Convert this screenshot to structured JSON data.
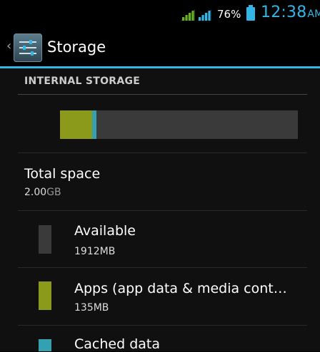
{
  "status_bar": {
    "battery_percent": "76%",
    "time": "12:38",
    "ampm": "AM",
    "colors": {
      "signal1": "#6ab023",
      "signal2": "#33b5e5",
      "accent": "#33b5e5"
    }
  },
  "action_bar": {
    "title": "Storage",
    "icon": "settings-sliders-icon"
  },
  "storage": {
    "section_header": "INTERNAL STORAGE",
    "bar_fraction": {
      "apps": 0.066,
      "cached": 0.01
    },
    "colors": {
      "available": "#3a3a3a",
      "apps": "#8b9a1b",
      "cached": "#33a1b0"
    },
    "total": {
      "label": "Total space",
      "value_num": "2.00",
      "value_unit": "GB"
    },
    "items": [
      {
        "label": "Available",
        "value": "1912MB",
        "color": "#3a3a3a"
      },
      {
        "label": "Apps (app data & media cont…",
        "value": "135MB",
        "color": "#8b9a1b"
      },
      {
        "label": "Cached data",
        "value": "",
        "color": "#33a1b0"
      }
    ]
  }
}
